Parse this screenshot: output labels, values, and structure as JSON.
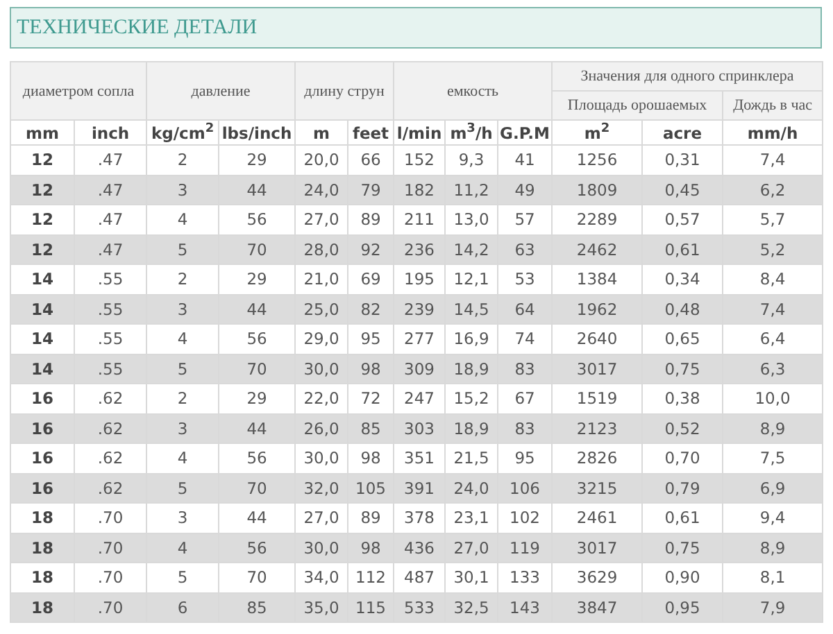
{
  "title": "ТЕХНИЧЕСКИЕ ДЕТАЛИ",
  "header": [
    {
      "label": "диаметром сопла",
      "children": [
        {
          "label": "mm"
        },
        {
          "label": "inch"
        }
      ]
    },
    {
      "label": "давление",
      "children": [
        {
          "label": "kg/cm$^{2}$"
        },
        {
          "label": "lbs/inch"
        }
      ]
    },
    {
      "label": "длину струн",
      "children": [
        {
          "label": "m"
        },
        {
          "label": "feet"
        }
      ]
    },
    {
      "label": "емкость",
      "children": [
        {
          "label": "l/min"
        },
        {
          "label": "m$^{3}$/h"
        },
        {
          "label": "G.P.M"
        }
      ]
    },
    {
      "label": "Значения для одного спринклера",
      "children": [
        {
          "label": "Площадь орошаемых",
          "children": [
            {
              "label": "m$^{2}$"
            },
            {
              "label": "acre"
            }
          ]
        },
        {
          "label": "Дождь в час",
          "children": [
            {
              "label": "mm/h"
            }
          ]
        }
      ]
    }
  ],
  "rows": [
    [
      "12",
      ".47",
      "2",
      "29",
      "20,0",
      "66",
      "152",
      "9,3",
      "41",
      "1256",
      "0,31",
      "7,4"
    ],
    [
      "12",
      ".47",
      "3",
      "44",
      "24,0",
      "79",
      "182",
      "11,2",
      "49",
      "1809",
      "0,45",
      "6,2"
    ],
    [
      "12",
      ".47",
      "4",
      "56",
      "27,0",
      "89",
      "211",
      "13,0",
      "57",
      "2289",
      "0,57",
      "5,7"
    ],
    [
      "12",
      ".47",
      "5",
      "70",
      "28,0",
      "92",
      "236",
      "14,2",
      "63",
      "2462",
      "0,61",
      "5,2"
    ],
    [
      "14",
      ".55",
      "2",
      "29",
      "21,0",
      "69",
      "195",
      "12,1",
      "53",
      "1384",
      "0,34",
      "8,4"
    ],
    [
      "14",
      ".55",
      "3",
      "44",
      "25,0",
      "82",
      "239",
      "14,5",
      "64",
      "1962",
      "0,48",
      "7,4"
    ],
    [
      "14",
      ".55",
      "4",
      "56",
      "29,0",
      "95",
      "277",
      "16,9",
      "74",
      "2640",
      "0,65",
      "6,4"
    ],
    [
      "14",
      ".55",
      "5",
      "70",
      "30,0",
      "98",
      "309",
      "18,9",
      "83",
      "3017",
      "0,75",
      "6,3"
    ],
    [
      "16",
      ".62",
      "2",
      "29",
      "22,0",
      "72",
      "247",
      "15,2",
      "67",
      "1519",
      "0,38",
      "10,0"
    ],
    [
      "16",
      ".62",
      "3",
      "44",
      "26,0",
      "85",
      "303",
      "18,9",
      "83",
      "2123",
      "0,52",
      "8,9"
    ],
    [
      "16",
      ".62",
      "4",
      "56",
      "30,0",
      "98",
      "351",
      "21,5",
      "95",
      "2826",
      "0,70",
      "7,5"
    ],
    [
      "16",
      ".62",
      "5",
      "70",
      "32,0",
      "105",
      "391",
      "24,0",
      "106",
      "3215",
      "0,79",
      "6,9"
    ],
    [
      "18",
      ".70",
      "3",
      "44",
      "27,0",
      "89",
      "378",
      "23,1",
      "102",
      "2461",
      "0,61",
      "9,4"
    ],
    [
      "18",
      ".70",
      "4",
      "56",
      "30,0",
      "98",
      "436",
      "27,0",
      "119",
      "3017",
      "0,75",
      "8,9"
    ],
    [
      "18",
      ".70",
      "5",
      "70",
      "34,0",
      "112",
      "487",
      "30,1",
      "133",
      "3629",
      "0,90",
      "8,1"
    ],
    [
      "18",
      ".70",
      "6",
      "85",
      "35,0",
      "115",
      "533",
      "32,5",
      "143",
      "3847",
      "0,95",
      "7,9"
    ]
  ]
}
